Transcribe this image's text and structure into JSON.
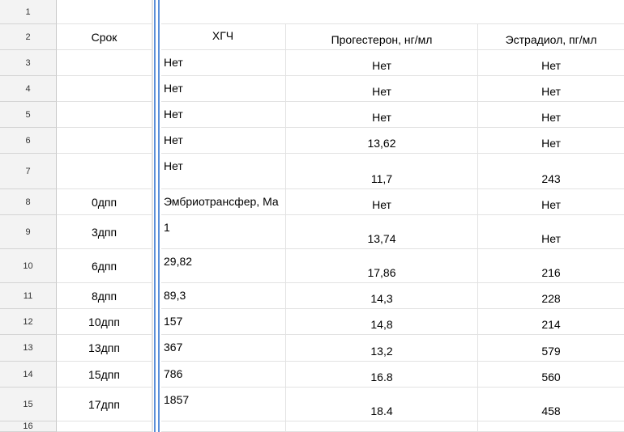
{
  "headers": {
    "term": "Срок",
    "hcg": "ХГЧ",
    "progesterone": "Прогестерон, нг/мл",
    "estradiol": "Эстрадиол, пг/мл"
  },
  "row_numbers": [
    "1",
    "2",
    "3",
    "4",
    "5",
    "6",
    "7",
    "8",
    "9",
    "10",
    "11",
    "12",
    "13",
    "14",
    "15",
    "16"
  ],
  "rows": [
    {
      "term": "",
      "hcg": "Нет",
      "progesterone": "Нет",
      "estradiol": "Нет"
    },
    {
      "term": "",
      "hcg": "Нет",
      "progesterone": "Нет",
      "estradiol": "Нет"
    },
    {
      "term": "",
      "hcg": "Нет",
      "progesterone": "Нет",
      "estradiol": "Нет"
    },
    {
      "term": "",
      "hcg": "Нет",
      "progesterone": "13,62",
      "estradiol": "Нет"
    },
    {
      "term": "",
      "hcg": "Нет",
      "progesterone": "11,7",
      "estradiol": "243"
    },
    {
      "term": "0дпп",
      "hcg": "Эмбриотрансфер, Ма",
      "progesterone": "Нет",
      "estradiol": "Нет"
    },
    {
      "term": "3дпп",
      "hcg": "1",
      "progesterone": "13,74",
      "estradiol": "Нет"
    },
    {
      "term": "6дпп",
      "hcg": "29,82",
      "progesterone": "17,86",
      "estradiol": "216"
    },
    {
      "term": "8дпп",
      "hcg": "89,3",
      "progesterone": "14,3",
      "estradiol": "228"
    },
    {
      "term": "10дпп",
      "hcg": "157",
      "progesterone": "14,8",
      "estradiol": "214"
    },
    {
      "term": "13дпп",
      "hcg": "367",
      "progesterone": "13,2",
      "estradiol": "579"
    },
    {
      "term": "15дпп",
      "hcg": "786",
      "progesterone": "16.8",
      "estradiol": "560"
    },
    {
      "term": "17дпп",
      "hcg": "1857",
      "progesterone": "18.4",
      "estradiol": "458"
    }
  ]
}
